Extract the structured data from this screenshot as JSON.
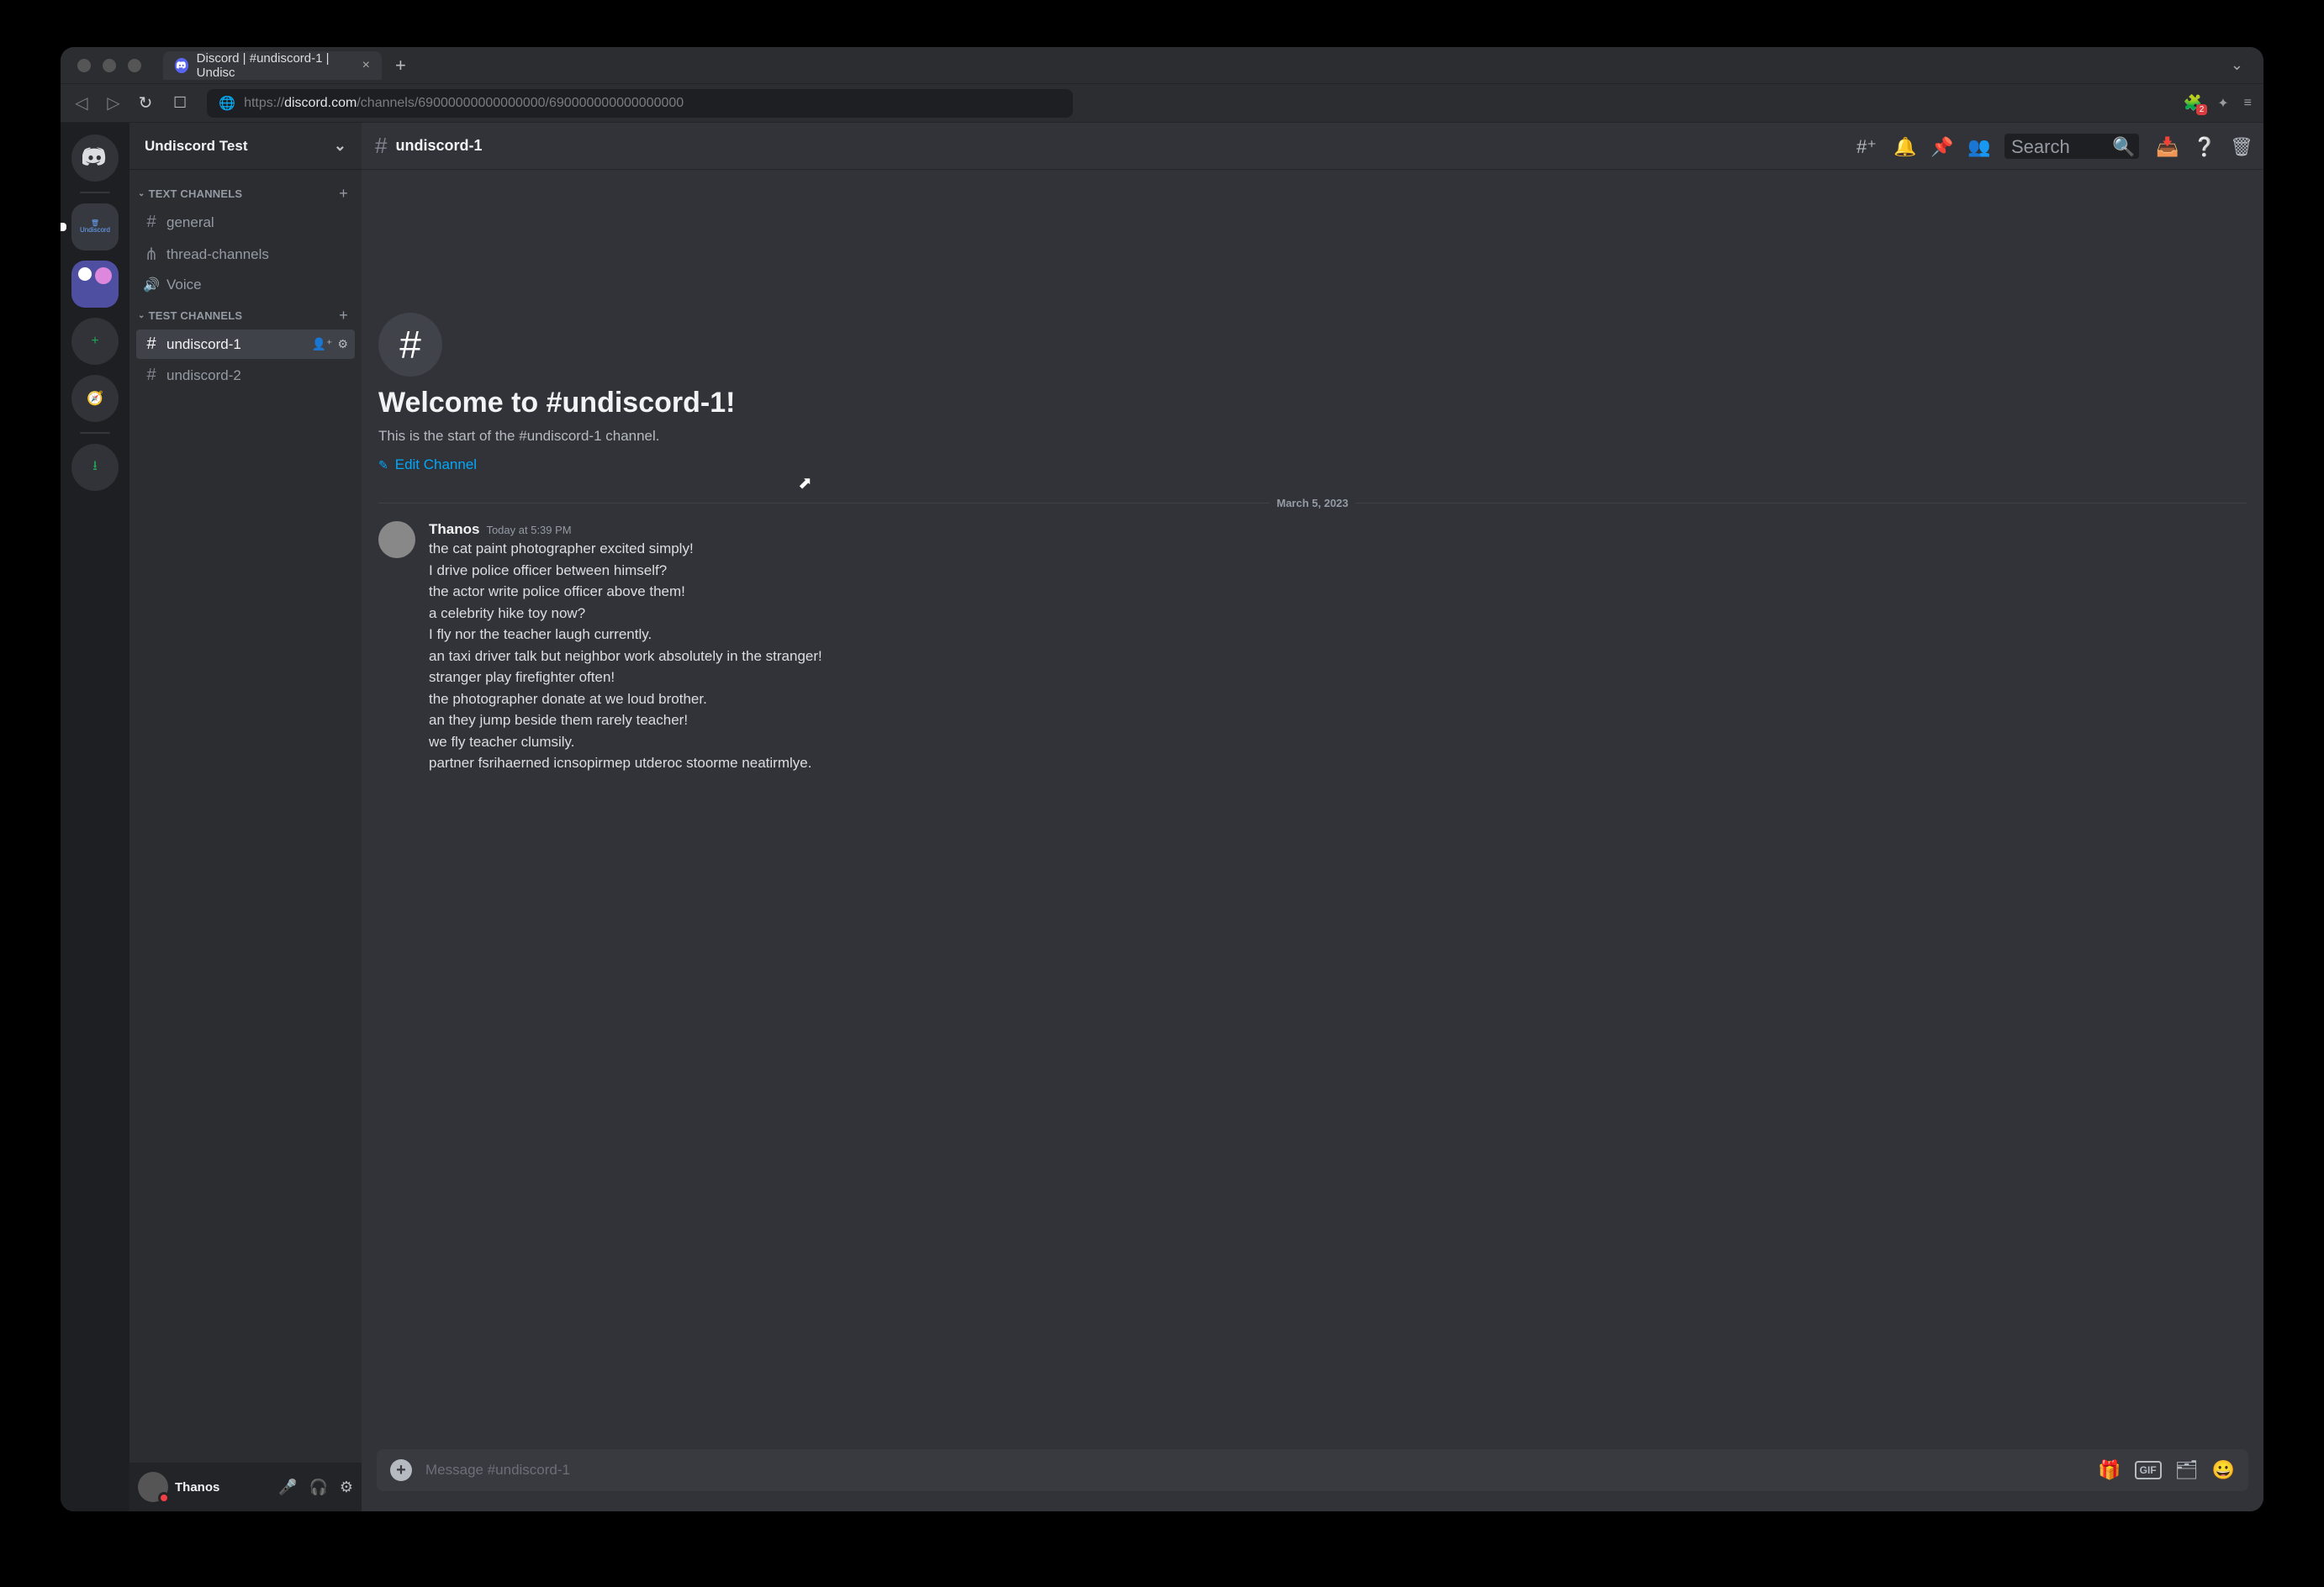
{
  "browser": {
    "tabTitle": "Discord | #undiscord-1 | Undisc",
    "urlPrefix": "https://",
    "urlHost": "discord.com",
    "urlPath": "/channels/69000000000000000/690000000000000000",
    "extBadge": "2"
  },
  "server": {
    "name": "Undiscord Test",
    "undiscordLabel": "Undiscord"
  },
  "categories": [
    {
      "label": "TEXT CHANNELS"
    },
    {
      "label": "TEST CHANNELS"
    }
  ],
  "channels": {
    "text": [
      {
        "name": "general",
        "type": "text"
      },
      {
        "name": "thread-channels",
        "type": "thread"
      },
      {
        "name": "Voice",
        "type": "voice"
      }
    ],
    "test": [
      {
        "name": "undiscord-1",
        "selected": true
      },
      {
        "name": "undiscord-2",
        "selected": false
      }
    ]
  },
  "user": {
    "name": "Thanos"
  },
  "chat": {
    "channel": "undiscord-1",
    "searchPlaceholder": "Search",
    "welcomeTitle": "Welcome to #undiscord-1!",
    "welcomeSub": "This is the start of the #undiscord-1 channel.",
    "editLabel": "Edit Channel",
    "dividerDate": "March 5, 2023",
    "msg": {
      "author": "Thanos",
      "timestamp": "Today at 5:39 PM",
      "lines": [
        "the cat paint photographer excited simply!",
        "I drive police officer between himself?",
        "the actor write police officer above them!",
        "a celebrity hike toy now?",
        "I fly nor the teacher laugh currently.",
        "an taxi driver talk but neighbor work absolutely in the stranger!",
        "stranger play firefighter often!",
        "the photographer donate at we loud brother.",
        "an they jump beside them rarely teacher!",
        "we fly teacher clumsily.",
        "partner fsrihaerned  icnsopirmep utderoc stoorme neatirmlye."
      ]
    },
    "inputPlaceholder": "Message #undiscord-1"
  },
  "gifLabel": "GIF"
}
